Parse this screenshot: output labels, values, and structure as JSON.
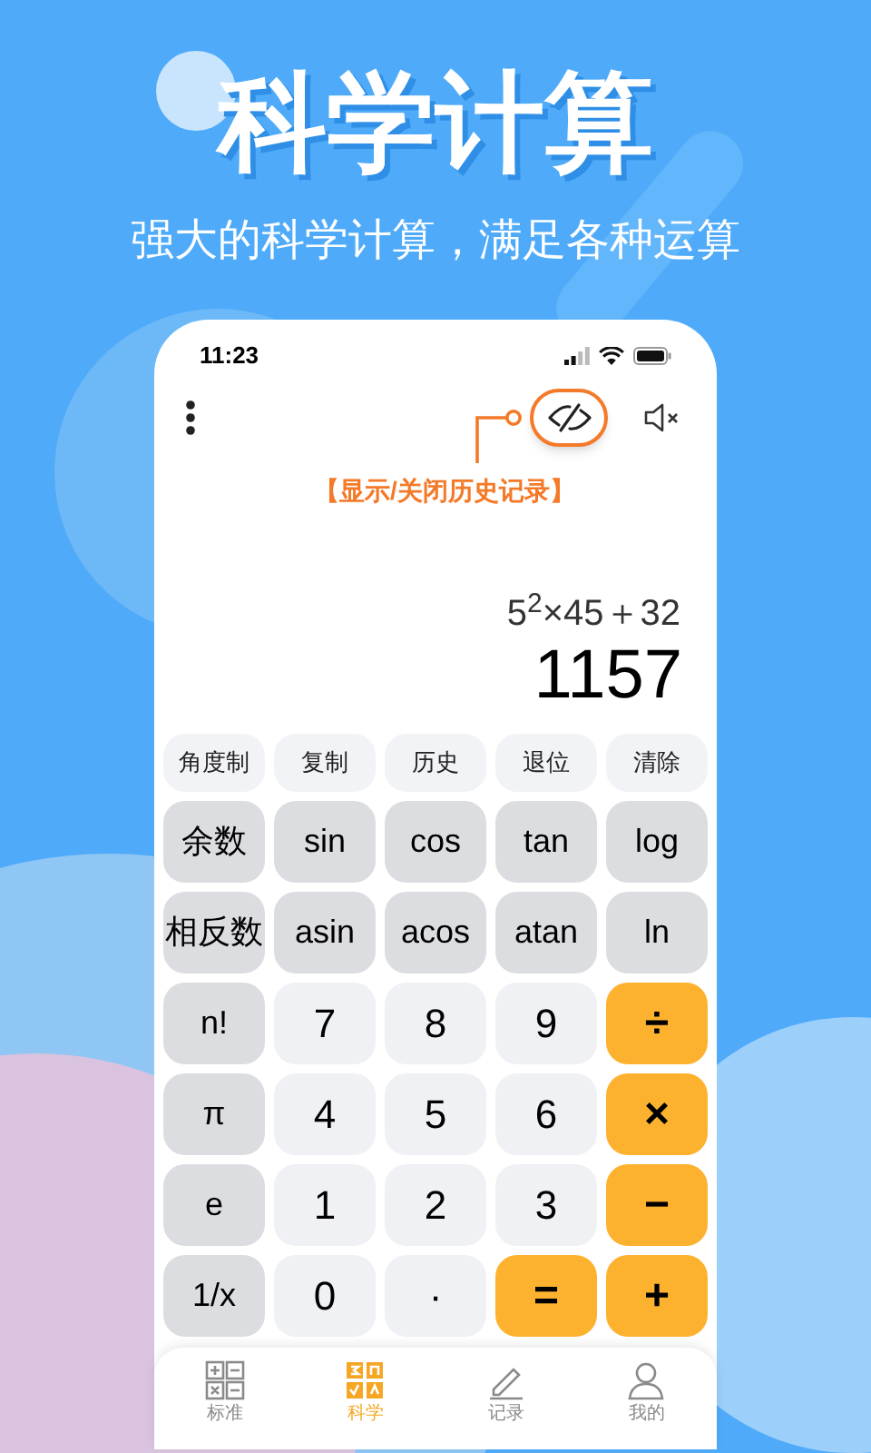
{
  "hero": {
    "title": "科学计算",
    "subtitle": "强大的科学计算，满足各种运算"
  },
  "status_bar": {
    "time": "11:23"
  },
  "annotation": "【显示/关闭历史记录】",
  "display": {
    "expression": "5$^{2}$×45＋32",
    "result": "1157"
  },
  "keys": [
    {
      "label": "角度制",
      "kind": "action"
    },
    {
      "label": "复制",
      "kind": "action"
    },
    {
      "label": "历史",
      "kind": "action"
    },
    {
      "label": "退位",
      "kind": "action"
    },
    {
      "label": "清除",
      "kind": "action"
    },
    {
      "label": "余数",
      "kind": "function"
    },
    {
      "label": "sin",
      "kind": "function"
    },
    {
      "label": "cos",
      "kind": "function"
    },
    {
      "label": "tan",
      "kind": "function"
    },
    {
      "label": "log",
      "kind": "function"
    },
    {
      "label": "相反数",
      "kind": "function"
    },
    {
      "label": "asin",
      "kind": "function"
    },
    {
      "label": "acos",
      "kind": "function"
    },
    {
      "label": "atan",
      "kind": "function"
    },
    {
      "label": "ln",
      "kind": "function"
    },
    {
      "label": "n!",
      "kind": "function"
    },
    {
      "label": "7",
      "kind": "digit"
    },
    {
      "label": "8",
      "kind": "digit"
    },
    {
      "label": "9",
      "kind": "digit"
    },
    {
      "label": "÷",
      "kind": "operator"
    },
    {
      "label": "π",
      "kind": "function"
    },
    {
      "label": "4",
      "kind": "digit"
    },
    {
      "label": "5",
      "kind": "digit"
    },
    {
      "label": "6",
      "kind": "digit"
    },
    {
      "label": "×",
      "kind": "operator"
    },
    {
      "label": "e",
      "kind": "function"
    },
    {
      "label": "1",
      "kind": "digit"
    },
    {
      "label": "2",
      "kind": "digit"
    },
    {
      "label": "3",
      "kind": "digit"
    },
    {
      "label": "−",
      "kind": "operator"
    },
    {
      "label": "1/x",
      "kind": "function"
    },
    {
      "label": "0",
      "kind": "digit"
    },
    {
      "label": "·",
      "kind": "digit"
    },
    {
      "label": "=",
      "kind": "operator"
    },
    {
      "label": "+",
      "kind": "operator"
    }
  ],
  "tabs": [
    {
      "label": "标准",
      "selected": false
    },
    {
      "label": "科学",
      "selected": true
    },
    {
      "label": "记录",
      "selected": false
    },
    {
      "label": "我的",
      "selected": false
    }
  ]
}
